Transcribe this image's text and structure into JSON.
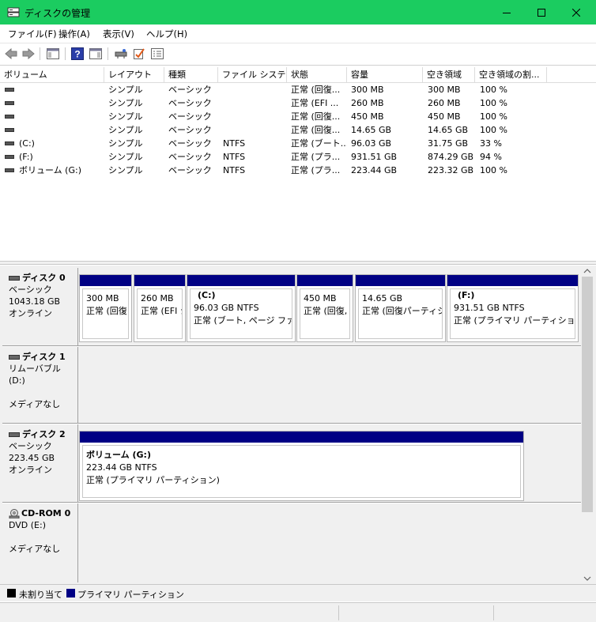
{
  "window": {
    "title": "ディスクの管理"
  },
  "menu": [
    "ファイル(F)",
    "操作(A)",
    "表示(V)",
    "ヘルプ(H)"
  ],
  "toolbar": [
    "back-icon",
    "forward-icon",
    "show-hide-console-tree-icon",
    "help-icon",
    "show-hide-action-pane-icon",
    "connect-drive-icon",
    "properties-check-icon",
    "settings-list-icon"
  ],
  "volume_list": {
    "columns": [
      "ボリューム",
      "レイアウト",
      "種類",
      "ファイル システム",
      "状態",
      "容量",
      "空き領域",
      "空き領域の割..."
    ],
    "rows": [
      [
        "",
        "シンプル",
        "ベーシック",
        "",
        "正常 (回復...",
        "300 MB",
        "300 MB",
        "100 %"
      ],
      [
        "",
        "シンプル",
        "ベーシック",
        "",
        "正常 (EFI ...",
        "260 MB",
        "260 MB",
        "100 %"
      ],
      [
        "",
        "シンプル",
        "ベーシック",
        "",
        "正常 (回復...",
        "450 MB",
        "450 MB",
        "100 %"
      ],
      [
        "",
        "シンプル",
        "ベーシック",
        "",
        "正常 (回復...",
        "14.65 GB",
        "14.65 GB",
        "100 %"
      ],
      [
        "(C:)",
        "シンプル",
        "ベーシック",
        "NTFS",
        "正常 (ブート...",
        "96.03 GB",
        "31.75 GB",
        "33 %"
      ],
      [
        "(F:)",
        "シンプル",
        "ベーシック",
        "NTFS",
        "正常 (プラ...",
        "931.51 GB",
        "874.29 GB",
        "94 %"
      ],
      [
        "ボリューム (G:)",
        "シンプル",
        "ベーシック",
        "NTFS",
        "正常 (プラ...",
        "223.44 GB",
        "223.32 GB",
        "100 %"
      ]
    ]
  },
  "disks": [
    {
      "name": "ディスク 0",
      "type": "ベーシック",
      "size": "1043.18 GB",
      "status": "オンライン",
      "partitions": [
        {
          "name": "",
          "size": "300 MB",
          "status": "正常 (回復"
        },
        {
          "name": "",
          "size": "260 MB",
          "status": "正常 (EFI シ"
        },
        {
          "name": "(C:)",
          "size": "96.03 GB NTFS",
          "status": "正常 (ブート, ページ ファイル"
        },
        {
          "name": "",
          "size": "450 MB",
          "status": "正常 (回復,"
        },
        {
          "name": "",
          "size": "14.65 GB",
          "status": "正常 (回復パーティシ"
        },
        {
          "name": "(F:)",
          "size": "931.51 GB NTFS",
          "status": "正常 (プライマリ パーティション)"
        }
      ]
    },
    {
      "name": "ディスク 1",
      "type": "リムーバブル (D:)",
      "size": "",
      "status": "メディアなし",
      "partitions": []
    },
    {
      "name": "ディスク 2",
      "type": "ベーシック",
      "size": "223.45 GB",
      "status": "オンライン",
      "partitions": [
        {
          "name": "ボリューム (G:)",
          "size": "223.44 GB NTFS",
          "status": "正常 (プライマリ パーティション)"
        }
      ]
    },
    {
      "name": "CD-ROM 0",
      "type": "DVD (E:)",
      "size": "",
      "status": "メディアなし",
      "partitions": []
    }
  ],
  "legend": [
    {
      "label": "未割り当て",
      "color": "#000000"
    },
    {
      "label": "プライマリ パーティション",
      "color": "#000084"
    }
  ],
  "colors": {
    "titlebar": "#1bcc60",
    "partition_bar": "#000084"
  }
}
